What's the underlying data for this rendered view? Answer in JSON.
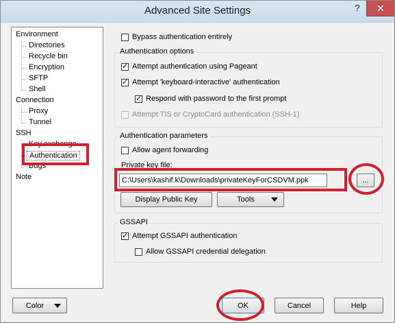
{
  "window": {
    "title": "Advanced Site Settings",
    "help_glyph": "?",
    "close_glyph": "✕"
  },
  "tree": {
    "environment": "Environment",
    "directories": "Directories",
    "recycle_bin": "Recycle bin",
    "encryption": "Encryption",
    "sftp": "SFTP",
    "shell": "Shell",
    "connection": "Connection",
    "proxy": "Proxy",
    "tunnel": "Tunnel",
    "ssh": "SSH",
    "key_exchange": "Key exchange",
    "authentication": "Authentication",
    "bugs": "Bugs",
    "note": "Note"
  },
  "auth": {
    "bypass": "Bypass authentication entirely",
    "options_group": "Authentication options",
    "pageant": "Attempt authentication using Pageant",
    "keyboard_interactive": "Attempt 'keyboard-interactive' authentication",
    "respond_password": "Respond with password to the first prompt",
    "tis": "Attempt TIS or CryptoCard authentication (SSH-1)",
    "params_group": "Authentication parameters",
    "agent_forwarding": "Allow agent forwarding",
    "private_key_label": "Private key file:",
    "private_key_value": "C:\\Users\\kashif.k\\Downloads\\privateKeyForCSDVM.ppk",
    "browse": "...",
    "display_public_key": "Display Public Key",
    "tools": "Tools",
    "gssapi_group": "GSSAPI",
    "gssapi_auth": "Attempt GSSAPI authentication",
    "gssapi_delegation": "Allow GSSAPI credential delegation"
  },
  "footer": {
    "color": "Color",
    "ok": "OK",
    "cancel": "Cancel",
    "help": "Help"
  },
  "annotation_color": "#d2202f"
}
